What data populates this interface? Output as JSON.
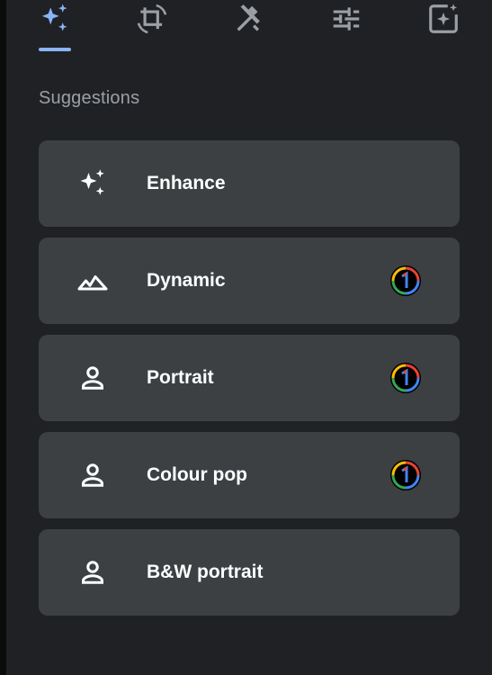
{
  "tabs": [
    {
      "name": "suggestions",
      "icon": "sparkle-icon",
      "active": true
    },
    {
      "name": "crop",
      "icon": "crop-rotate-icon",
      "active": false
    },
    {
      "name": "tools",
      "icon": "tools-icon",
      "active": false
    },
    {
      "name": "adjust",
      "icon": "sliders-icon",
      "active": false
    },
    {
      "name": "filters",
      "icon": "filter-sparkle-icon",
      "active": false
    }
  ],
  "colors": {
    "accent": "#8ab4f8",
    "background": "#202124",
    "card": "#3c4043",
    "section_title": "#9aa0a6"
  },
  "section_title": "Suggestions",
  "suggestions": [
    {
      "label": "Enhance",
      "icon": "sparkle-icon",
      "badge": false
    },
    {
      "label": "Dynamic",
      "icon": "landscape-icon",
      "badge": true,
      "badge_icon": "google-one-icon"
    },
    {
      "label": "Portrait",
      "icon": "person-icon",
      "badge": true,
      "badge_icon": "google-one-icon"
    },
    {
      "label": "Colour pop",
      "icon": "person-icon",
      "badge": true,
      "badge_icon": "google-one-icon"
    },
    {
      "label": "B&W portrait",
      "icon": "person-icon",
      "badge": false
    }
  ]
}
